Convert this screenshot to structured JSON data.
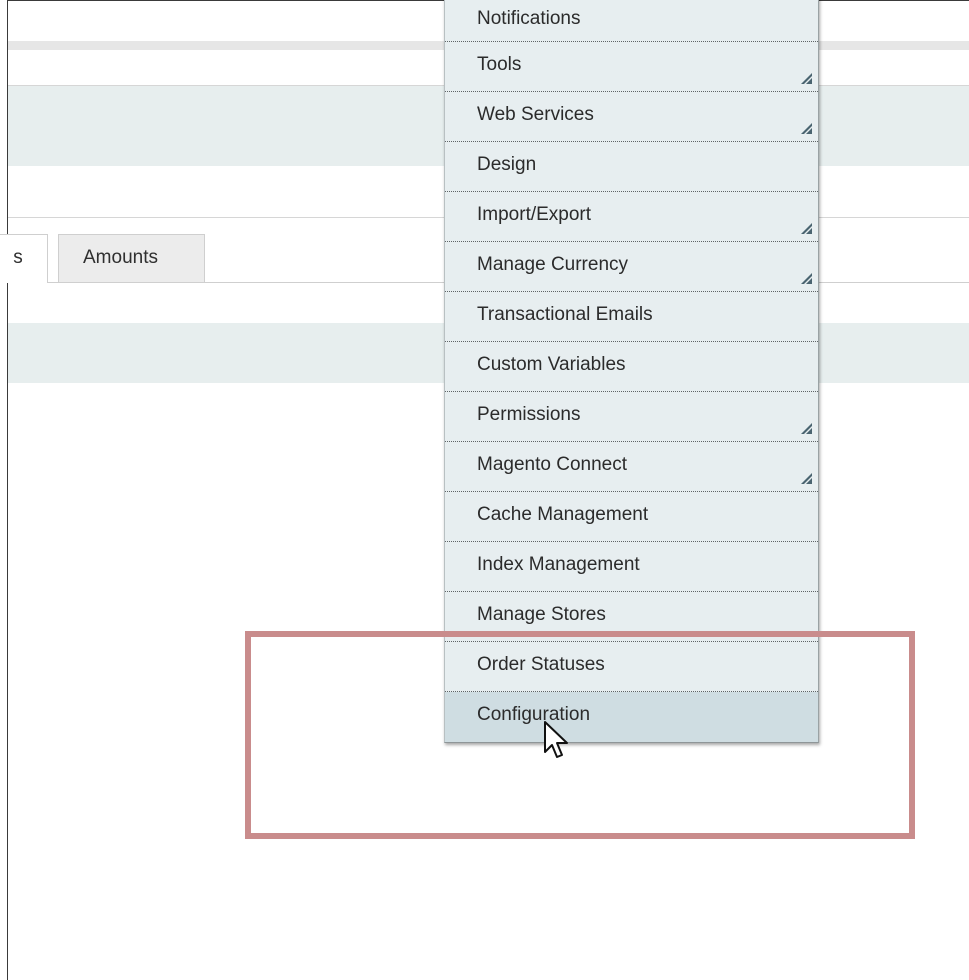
{
  "tabs": {
    "partial_label": "s",
    "amounts_label": "Amounts"
  },
  "menu": {
    "items": [
      {
        "label": "Notifications",
        "submenu": false
      },
      {
        "label": "Tools",
        "submenu": true
      },
      {
        "label": "Web Services",
        "submenu": true
      },
      {
        "label": "Design",
        "submenu": false
      },
      {
        "label": "Import/Export",
        "submenu": true
      },
      {
        "label": "Manage Currency",
        "submenu": true
      },
      {
        "label": "Transactional Emails",
        "submenu": false
      },
      {
        "label": "Custom Variables",
        "submenu": false
      },
      {
        "label": "Permissions",
        "submenu": true
      },
      {
        "label": "Magento Connect",
        "submenu": true
      },
      {
        "label": "Cache Management",
        "submenu": false
      },
      {
        "label": "Index Management",
        "submenu": false
      },
      {
        "label": "Manage Stores",
        "submenu": false
      },
      {
        "label": "Order Statuses",
        "submenu": false
      },
      {
        "label": "Configuration",
        "submenu": false,
        "active": true
      }
    ]
  },
  "colors": {
    "annotation_box": "#c98c8c",
    "menu_bg": "#e7eef0",
    "menu_active_bg": "#cfdde2"
  }
}
